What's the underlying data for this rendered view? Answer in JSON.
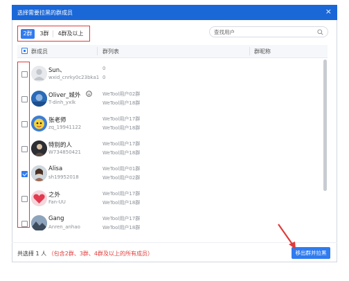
{
  "dialog": {
    "title": "选择需要拉黑的群成员",
    "close_symbol": "×",
    "colors": {
      "primary": "#2f7bf0",
      "titlebar": "#1a67d8",
      "highlight": "#e03b3b"
    }
  },
  "tabs": [
    {
      "label": "2群",
      "active": true
    },
    {
      "label": "3群",
      "active": false
    },
    {
      "label": "4群及以上",
      "active": false
    }
  ],
  "search": {
    "placeholder": "查找用户",
    "value": ""
  },
  "table": {
    "headers": {
      "member": "群成员",
      "groups": "群列表",
      "nickname": "群昵称"
    }
  },
  "members": [
    {
      "name": "Sun、",
      "sub": "wxid_cnrky0c23bka1",
      "groups": [
        "0",
        "0"
      ],
      "checked": false,
      "avatar": "default-avatar"
    },
    {
      "name": "Oliver_城外",
      "sub": "T-dinh_yxlk",
      "groups": [
        "WeTool用户02群",
        "WeTool用户18群"
      ],
      "checked": false,
      "avatar": "blue-avatar"
    },
    {
      "name": "张老师",
      "sub": "zq_19941122",
      "groups": [
        "WeTool用户17群",
        "WeTool用户18群"
      ],
      "checked": false,
      "avatar": "cartoon-avatar"
    },
    {
      "name": "特别的人",
      "sub": "W734850421",
      "groups": [
        "WeTool用户17群",
        "WeTool用户18群"
      ],
      "checked": false,
      "avatar": "dark-avatar"
    },
    {
      "name": "Alisa",
      "sub": "sh19952018",
      "groups": [
        "WeTool用户01群",
        "WeTool用户02群"
      ],
      "checked": true,
      "avatar": "photo-avatar"
    },
    {
      "name": "之外",
      "sub": "Fan-UU",
      "groups": [
        "WeTool用户17群",
        "WeTool用户18群"
      ],
      "checked": false,
      "avatar": "heart-avatar"
    },
    {
      "name": "Gang",
      "sub": "Anren_anhao",
      "groups": [
        "WeTool用户17群",
        "WeTool用户18群"
      ],
      "checked": false,
      "avatar": "mountain-avatar"
    }
  ],
  "footer": {
    "selected": "共选择 1 人",
    "hint": "（包含2群、3群、4群及以上的所有成员）",
    "button": "移出群并拉黑"
  }
}
